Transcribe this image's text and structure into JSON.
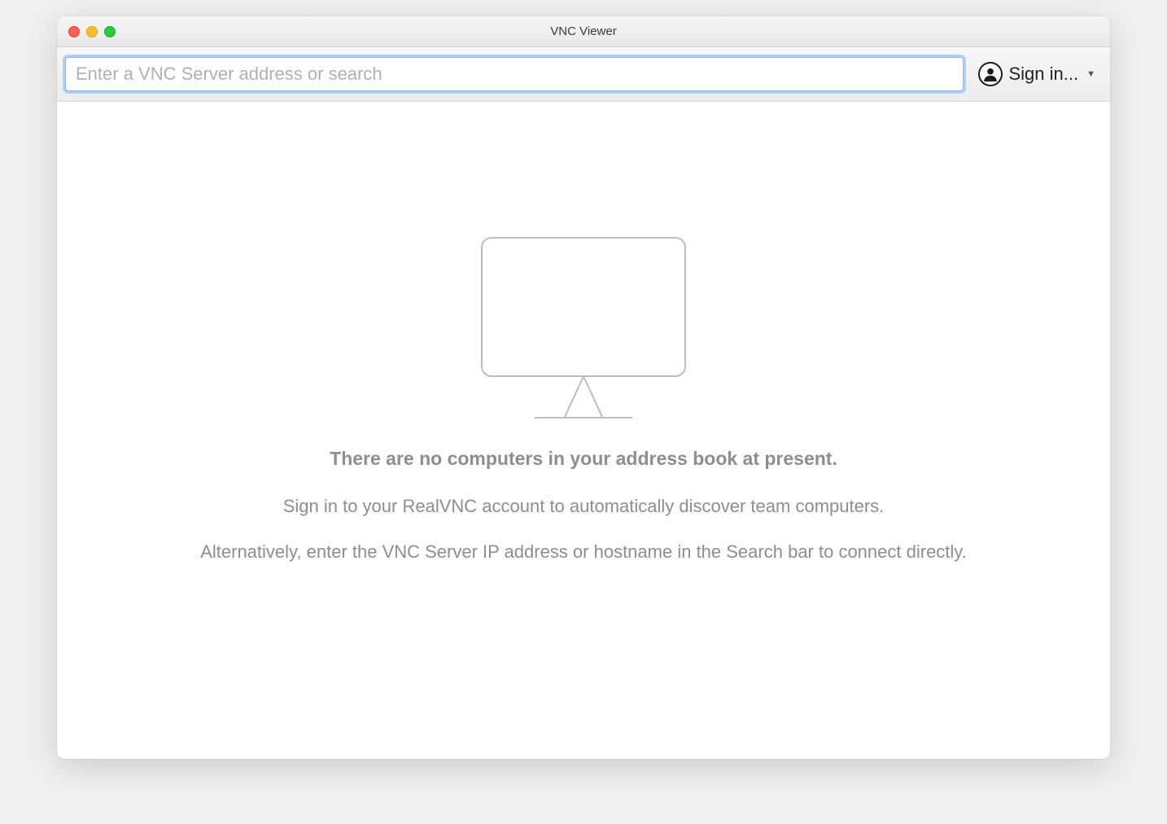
{
  "window": {
    "title": "VNC Viewer"
  },
  "toolbar": {
    "address_placeholder": "Enter a VNC Server address or search",
    "address_value": "",
    "signin_label": "Sign in..."
  },
  "empty_state": {
    "heading": "There are no computers in your address book at present.",
    "line1": "Sign in to your RealVNC account to automatically discover team computers.",
    "line2": "Alternatively, enter the VNC Server IP address or hostname in the Search bar to connect directly."
  }
}
